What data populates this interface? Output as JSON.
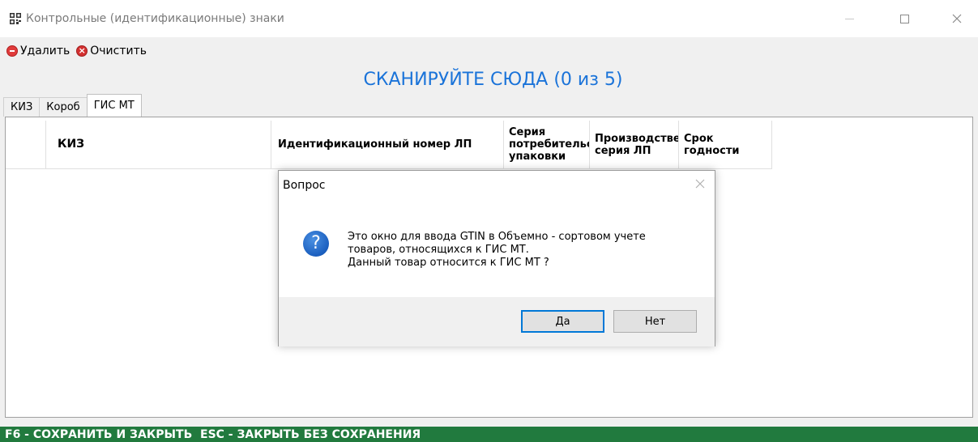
{
  "window": {
    "title": "Контрольные (идентификационные) знаки"
  },
  "toolbar": {
    "delete_label": "Удалить",
    "clear_label": "Очистить"
  },
  "scan": {
    "title": "СКАНИРУЙТЕ СЮДА (0 из 5)"
  },
  "tabs": [
    {
      "label": "КИЗ"
    },
    {
      "label": "Короб"
    },
    {
      "label": "ГИС МТ",
      "active": true
    }
  ],
  "grid": {
    "columns": [
      {
        "label": ""
      },
      {
        "label": "КИЗ"
      },
      {
        "label": "Идентификационный номер ЛП"
      },
      {
        "label": "Серия потребительской упаковки"
      },
      {
        "label": "Производственная серия ЛП"
      },
      {
        "label": "Срок годности"
      }
    ]
  },
  "dialog": {
    "title": "Вопрос",
    "message_lines": [
      "Это окно для ввода GTIN в Объемно - сортовом учете",
      "товаров, относящихся к ГИС МТ.",
      "Данный товар относится к ГИС МТ ?"
    ],
    "yes_label": "Да",
    "no_label": "Нет",
    "icon": "question-icon"
  },
  "footer": {
    "text": "F6 - СОХРАНИТЬ И ЗАКРЫТЬ  ESC - ЗАКРЫТЬ БЕЗ СОХРАНЕНИЯ"
  },
  "colors": {
    "scan_title": "#1a73d9",
    "footer_bg": "#217a3e",
    "dialog_icon": "#1b5fbf"
  }
}
